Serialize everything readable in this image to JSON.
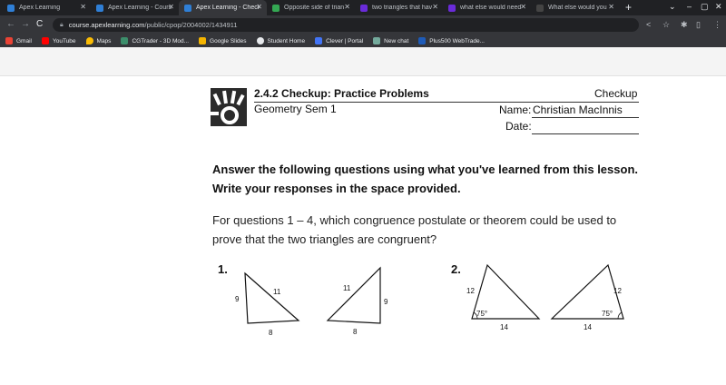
{
  "browser": {
    "tabs": [
      {
        "title": "Apex Learning",
        "active": false,
        "color": "#2f7fd6"
      },
      {
        "title": "Apex Learning - Cours",
        "active": false,
        "color": "#2f7fd6"
      },
      {
        "title": "Apex Learning - Check",
        "active": true,
        "color": "#2f7fd6"
      },
      {
        "title": "Opposite side of trian",
        "active": false,
        "color": "#34a853"
      },
      {
        "title": "two triangles that hav",
        "active": false,
        "color": "#6a2bd9"
      },
      {
        "title": "what else would need",
        "active": false,
        "color": "#6a2bd9"
      },
      {
        "title": "What else would you",
        "active": false,
        "color": "#444444"
      }
    ],
    "url_host": "course.apexlearning.com",
    "url_path": "/public/cpop/2004002/1434911",
    "bookmarks": [
      {
        "label": "Gmail",
        "color": "#ea4335"
      },
      {
        "label": "YouTube",
        "color": "#ff0000"
      },
      {
        "label": "Maps",
        "color": "#fbbc04"
      },
      {
        "label": "CGTrader - 3D Mod...",
        "color": "#3c8e6b"
      },
      {
        "label": "Google Slides",
        "color": "#f4b400"
      },
      {
        "label": "Student Home",
        "color": "#e8eaed"
      },
      {
        "label": "Clever | Portal",
        "color": "#4274f6"
      },
      {
        "label": "New chat",
        "color": "#74aa9c"
      },
      {
        "label": "Plus500 WebTrade...",
        "color": "#1e5bb8"
      }
    ]
  },
  "page": {
    "lesson_title": "2.4.2  Checkup:  Practice Problems",
    "course": "Geometry Sem 1",
    "doc_type": "Checkup",
    "name_label": "Name:",
    "name_value": "Christian MacInnis",
    "date_label": "Date:",
    "instructions": "Answer the following questions using what you've learned from this lesson. Write your responses in the space provided.",
    "question_intro": "For questions 1 – 4, which congruence postulate or theorem could be used to prove that the two triangles are congruent?"
  },
  "problems": [
    {
      "number": "1.",
      "triangle_a": {
        "side_left": "9",
        "side_hyp": "11",
        "side_bottom": "8"
      },
      "triangle_b": {
        "side_hyp": "11",
        "side_right": "9",
        "side_bottom": "8"
      }
    },
    {
      "number": "2.",
      "triangle_a": {
        "side_left": "12",
        "angle": "75°",
        "side_bottom": "14"
      },
      "triangle_b": {
        "side_right": "12",
        "angle": "75°",
        "side_bottom": "14"
      }
    }
  ]
}
